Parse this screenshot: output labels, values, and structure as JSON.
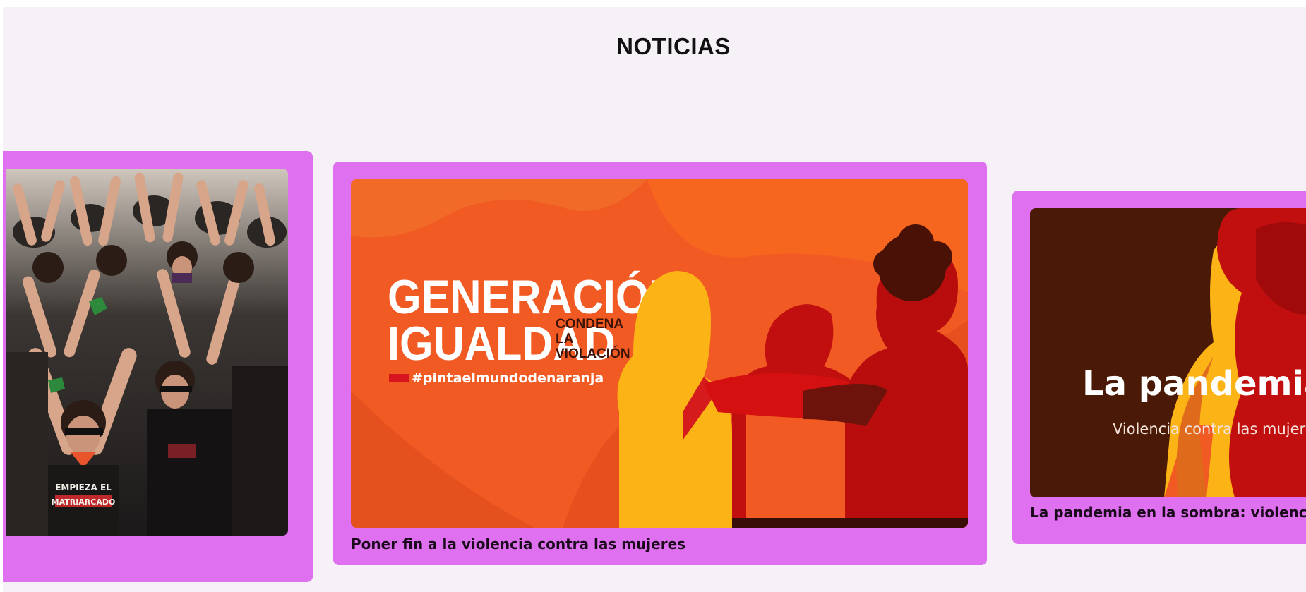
{
  "section": {
    "title": "NOTICIAS"
  },
  "cards": [
    {
      "caption": "",
      "image": {
        "shirt_text_line1": "EMPIEZA EL",
        "shirt_text_line2": "MATRIARCADO"
      }
    },
    {
      "caption": "Poner fin a la violencia contra las mujeres",
      "image": {
        "headline_line1": "GENERACIÓN",
        "headline_line2": "IGUALDAD",
        "side_line1": "CONDENA",
        "side_line2": "LA",
        "side_line3": "VIOLACIÓN",
        "hashtag": "#pintaelmundodenaranja"
      }
    },
    {
      "caption": "La pandemia en la sombra: violencia contra las mujeres",
      "image": {
        "headline": "La pandemia en la sombra",
        "subline": "Violencia contra las mujeres"
      }
    }
  ],
  "colors": {
    "page_background": "#f5f1f6",
    "card_background": "#df70f0",
    "orange": "#f15a22",
    "dark_brown": "#4a1a06"
  }
}
